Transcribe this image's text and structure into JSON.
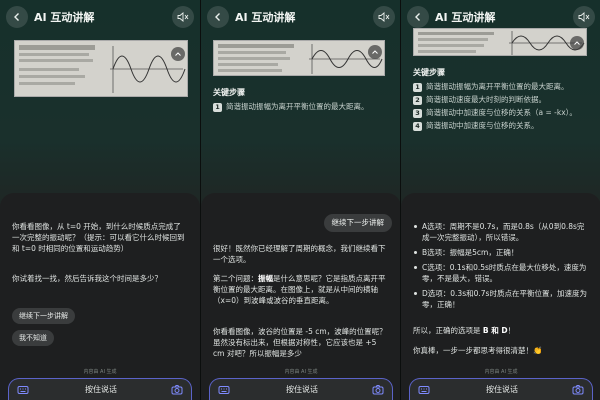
{
  "header": {
    "title": "AI 互动讲解"
  },
  "panel1": {
    "msg1": "你看看图像，从 t=0 开始，到什么时候质点完成了一次完整的振动呢？（提示：可以看它什么时候回到和 t=0 时相同的位置和运动趋势）",
    "msg2": "你试着找一找，然后告诉我这个时间是多少？",
    "chip1": "继续下一步讲解",
    "chip2": "我不知道"
  },
  "panel2": {
    "steps_title": "关键步骤",
    "steps": [
      "简谐振动振幅为离开平衡位置的最大距离。"
    ],
    "user_bubble": "继续下一步讲解",
    "msg1": "很好！既然你已经理解了周期的概念，我们继续看下一个选项。",
    "msg2_a": "第二个问题：",
    "msg2_b": "振幅",
    "msg2_c": "是什么意思呢？它是指质点离开平衡位置的最大距离。在图像上，就是从中间的横轴（x=0）到波峰或波谷的垂直距离。",
    "msg3": "你看看图像，波谷的位置是 -5 cm，波峰的位置呢？虽然没有标出来，但根据对称性，它应该也是 +5 cm 对吧？所以振幅是多少"
  },
  "panel3": {
    "steps_title": "关键步骤",
    "steps": [
      "简谐振动振幅为离开平衡位置的最大距离。",
      "简谐振动速度最大时刻的判断依据。",
      "简谐振动中加速度与位移的关系（a = -kx）。",
      "简谐振动中加速度与位移的关系。"
    ],
    "bullets": [
      "A选项：周期不是0.7s，而是0.8s（从0到0.8s完成一次完整振动），所以错误。",
      "B选项：振幅是5cm，正确！",
      "C选项：0.1s和0.5s时质点在最大位移处，速度为零，不是最大，错误。",
      "D选项：0.3s和0.7s时质点在平衡位置，加速度为零，正确！"
    ],
    "conclusion_a": "所以，正确的选项是 ",
    "conclusion_b": "B 和 D",
    "conclusion_c": "！",
    "praise": "你真棒，一步一步都思考得很清楚！👏"
  },
  "footer": {
    "disclaimer": "内容由 AI 生成",
    "talk_label": "按住说话"
  },
  "icons": {
    "back": "back-arrow-icon",
    "sound": "speaker-mute-icon",
    "keyboard": "keyboard-switch-icon",
    "camera": "camera-icon",
    "shrink": "collapse-icon"
  },
  "colors": {
    "accent_border": "#5b63c9",
    "panel_bg_top": "#16302b",
    "card_bg": "#1e1f20"
  }
}
